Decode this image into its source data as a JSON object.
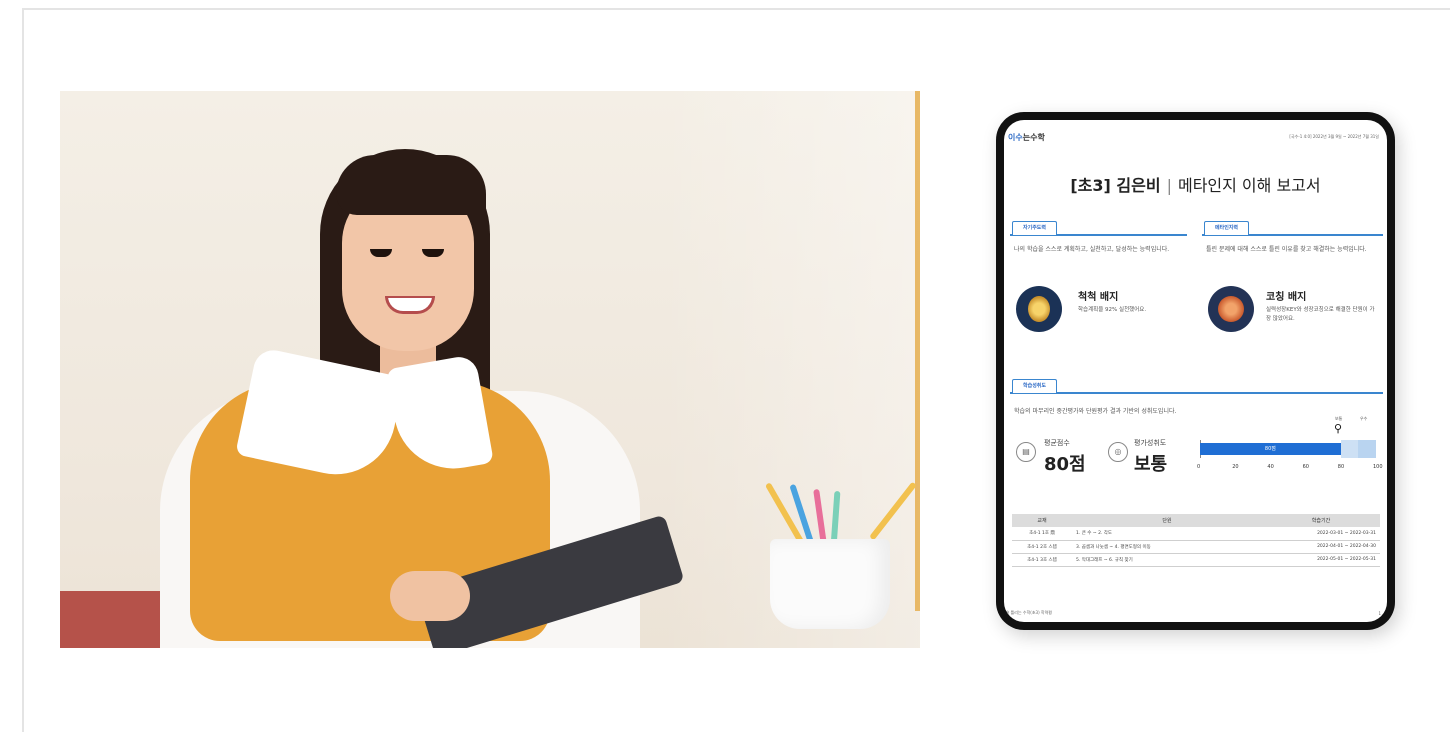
{
  "report": {
    "brand_part1": "이수",
    "brand_part2": "는수학",
    "period": "[국수-1 4:0] 2022년 3월 9일 ~ 2022년 7월 31일",
    "title_bold": "[초3] 김은비",
    "title_sep": "|",
    "title_sub": "메타인지 이해 보고서",
    "sections": {
      "self_directed": {
        "tab": "자기주도력",
        "description": "나의 학습을 스스로 계획하고, 실천하고, 달성하는 능력입니다.",
        "badge_name": "척척 배지",
        "badge_desc": "학습계획을 92% 실천했어요."
      },
      "metacognition": {
        "tab": "메타인지력",
        "description": "틀린 문제에 대해 스스로 틀린 이유를 찾고 해결하는 능력입니다.",
        "badge_name": "코칭 배지",
        "badge_desc": "실력성장KEY와 성장코칭으로 해결한 단원이 가장 많았어요."
      },
      "achievement": {
        "tab": "학습성취도",
        "description": "학습의 마무리인 중간평가와 단원평가 결과 기반의 성취도입니다.",
        "avg_label": "평균점수",
        "avg_value": "80점",
        "level_label": "평가성취도",
        "level_value": "보통",
        "bar_label": "80점",
        "zone_labels": [
          "보통",
          "우수"
        ],
        "ticks": [
          "0",
          "20",
          "40",
          "60",
          "80",
          "100"
        ]
      }
    },
    "table": {
      "headers": [
        "교재",
        "단원",
        "학습기간"
      ],
      "rows": [
        [
          "초4-1 1호 鼎",
          "1. 큰 수 ~ 2. 각도",
          "2022-03-01 ~ 2022-03-31"
        ],
        [
          "초4-1 2호 스텝",
          "3. 곱셈과 나눗셈 ~ 4. 평면도형의 이동",
          "2022-04-01 ~ 2022-04-30"
        ],
        [
          "초4-1 3호 스텝",
          "5. 막대그래프 ~ 6. 규칙 찾기",
          "2022-05-01 ~ 2022-05-31"
        ]
      ]
    },
    "footer_note": "※ 틀리는 수학(초3) 학력평",
    "page_no": "1"
  },
  "chart_data": {
    "type": "bar",
    "categories": [
      "평가성취도"
    ],
    "values": [
      80
    ],
    "xlim": [
      0,
      100
    ],
    "data_labels": [
      "80점"
    ],
    "zones": [
      {
        "name": "보통",
        "from": 80,
        "to": 90
      },
      {
        "name": "우수",
        "from": 90,
        "to": 100
      }
    ],
    "ticks": [
      0,
      20,
      40,
      60,
      80,
      100
    ]
  },
  "colors": {
    "accent": "#3a86cf",
    "bar": "#1f6ed4",
    "zone": "#cde0f4",
    "vest": "#e8a136"
  }
}
